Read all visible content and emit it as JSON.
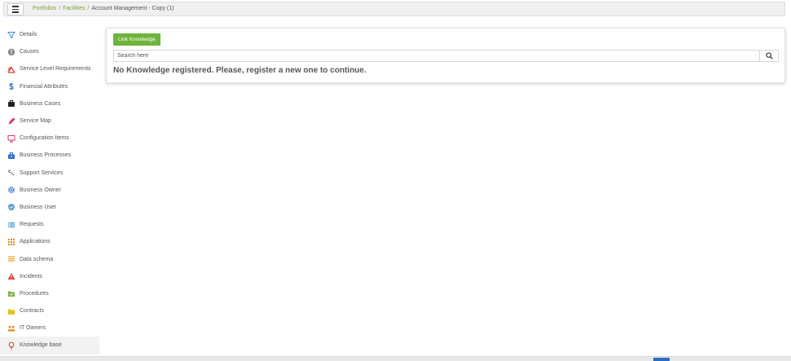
{
  "header": {
    "menu_icon": "hamburger-icon",
    "breadcrumb": [
      {
        "label": "Portfolios",
        "link": true
      },
      {
        "label": "Facilities",
        "link": true
      },
      {
        "label": "Account Management - Copy (1)",
        "link": false
      }
    ]
  },
  "sidebar": {
    "items": [
      {
        "label": "Details",
        "icon": "filter-icon",
        "color": "#3a8fd8"
      },
      {
        "label": "Causes",
        "icon": "alert-circle-icon",
        "color": "#8a8a8a"
      },
      {
        "label": "Service Level Requirements",
        "icon": "sla-icon",
        "color": "#e0392b"
      },
      {
        "label": "Financial Attributes",
        "icon": "dollar-icon",
        "color": "#2e6ccf"
      },
      {
        "label": "Business Cases",
        "icon": "briefcase-icon",
        "color": "#222222"
      },
      {
        "label": "Service Map",
        "icon": "pencil-icon",
        "color": "#d6336c"
      },
      {
        "label": "Configuration Items",
        "icon": "monitor-icon",
        "color": "#d6336c"
      },
      {
        "label": "Business Processes",
        "icon": "toolbox-icon",
        "color": "#2e6ccf"
      },
      {
        "label": "Support Services",
        "icon": "wrench-icon",
        "color": "#333333"
      },
      {
        "label": "Business Owner",
        "icon": "gear-icon",
        "color": "#2e6ccf"
      },
      {
        "label": "Business User",
        "icon": "shield-icon",
        "color": "#5aa0d8"
      },
      {
        "label": "Requests",
        "icon": "list-icon",
        "color": "#3a8fd8"
      },
      {
        "label": "Applications",
        "icon": "grid-icon",
        "color": "#e88a1a"
      },
      {
        "label": "Data schema",
        "icon": "lines-icon",
        "color": "#e8a21a"
      },
      {
        "label": "Incidents",
        "icon": "warning-icon",
        "color": "#e0392b"
      },
      {
        "label": "Procedures",
        "icon": "folder-check-icon",
        "color": "#7cb342"
      },
      {
        "label": "Contracts",
        "icon": "folder-icon",
        "color": "#e8c21a"
      },
      {
        "label": "IT Owners",
        "icon": "users-icon",
        "color": "#e88a1a"
      },
      {
        "label": "Knowledge base",
        "icon": "lightbulb-icon",
        "color": "#e04a3a"
      }
    ],
    "active_index": 18
  },
  "main": {
    "link_button_label": "Link Knowledge",
    "search_placeholder": "Search here",
    "search_icon": "search-icon",
    "empty_message": "No Knowledge registered. Please, register a new one to continue."
  },
  "colors": {
    "accent_green": "#6eb43c",
    "breadcrumb_link": "#7aa33c"
  }
}
